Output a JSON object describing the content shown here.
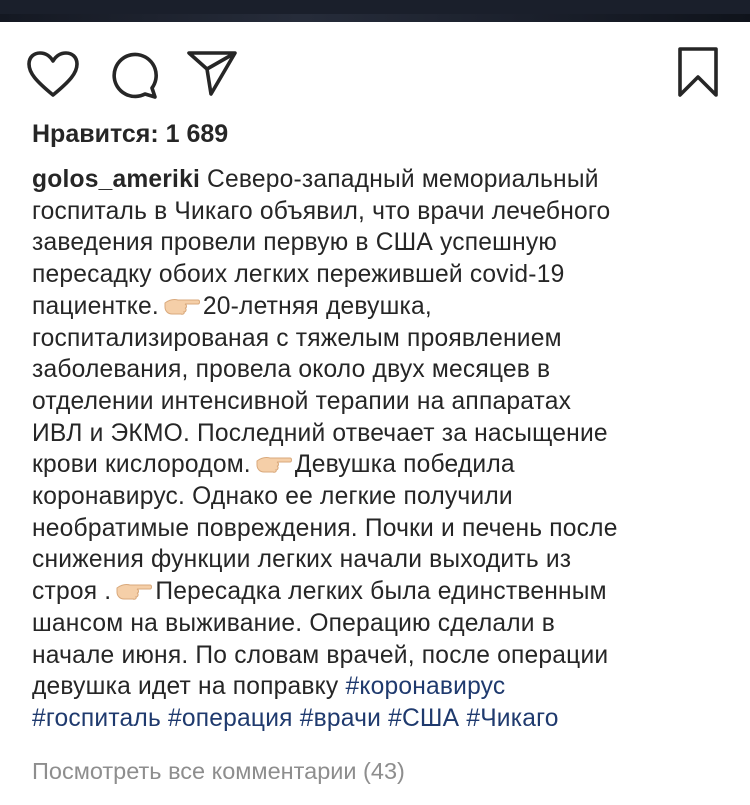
{
  "colors": {
    "text": "#262626",
    "hashtag": "#1f3a6e",
    "muted": "#8e8e8e",
    "strip": "#1a1f2b"
  },
  "icons": {
    "like": "heart-outline-icon",
    "comment": "speech-bubble-icon",
    "share": "paper-plane-icon",
    "save": "bookmark-icon",
    "pointer": "backhand-index-pointing-right-emoji"
  },
  "post": {
    "likes_label": "Нравится: 1 689",
    "username": "golos_ameriki",
    "caption": {
      "l1": "Северо-западный мемориальный",
      "l2": "госпиталь в Чикаго объявил, что врачи лечебного",
      "l3": "заведения провели первую в США успешную",
      "l4": "пересадку обоих легких пережившей covid-19",
      "l5a": "пациентке.",
      "l5b": "20-летняя девушка,",
      "l6": "госпитализированая с тяжелым проявлением",
      "l7": "заболевания, провела около двух месяцев в",
      "l8": "отделении интенсивной терапии на аппаратах",
      "l9": "ИВЛ и ЭКМО. Последний отвечает за насыщение",
      "l10a": "крови кислородом.",
      "l10b": "Девушка победила",
      "l11": "коронавирус. Однако ее легкие получили",
      "l12": "необратимые повреждения. Почки и печень после",
      "l13": "снижения функции легких начали выходить из",
      "l14a": "строя .",
      "l14b": "Пересадка легких была единственным",
      "l15": "шансом на выживание. Операцию сделали в",
      "l16": "начале июня. По словам врачей, после операции",
      "l17": "девушка идет на поправку"
    },
    "hashtags": [
      "#коронавирус",
      "#госпиталь",
      "#операция",
      "#врачи",
      "#США",
      "#Чикаго"
    ],
    "view_comments_label": "Посмотреть все комментарии (43)"
  }
}
